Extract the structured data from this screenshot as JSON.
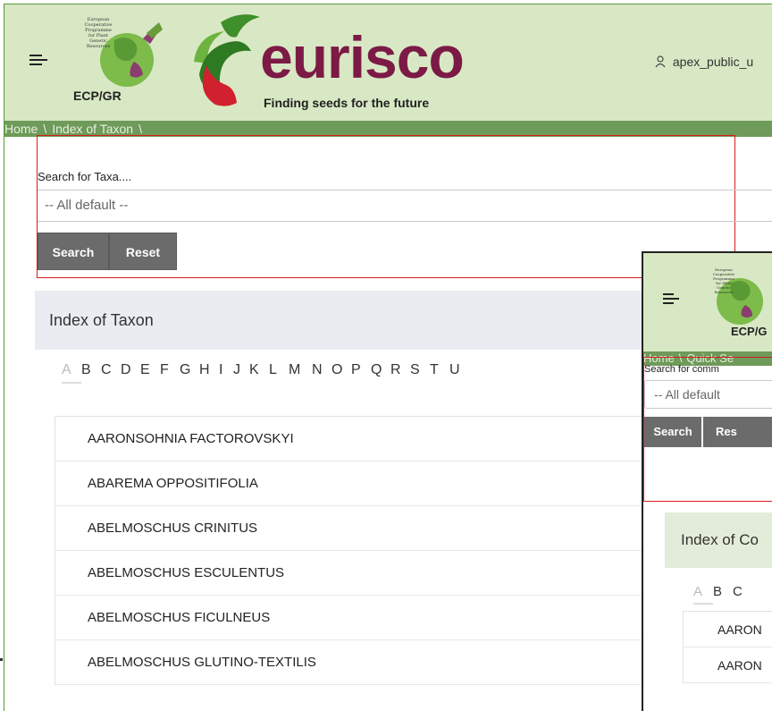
{
  "main_window": {
    "header": {
      "ecpgr_logo": {
        "text": "European\nCooperative\nProgramme\nfor Plant\nGenetic\nResources",
        "abbr": "ECP/GR"
      },
      "eurisco_logo": {
        "wordmark": "eurisco",
        "tagline": "Finding seeds for the future"
      },
      "user": {
        "icon": "user-icon",
        "name": "apex_public_u"
      },
      "menu_icon": "hamburger-icon"
    },
    "breadcrumb": [
      "Home",
      "Index of Taxon"
    ],
    "search": {
      "label": "Search for Taxa....",
      "select_value": "-- All default --",
      "search_button": "Search",
      "reset_button": "Reset"
    },
    "index": {
      "title": "Index of Taxon",
      "letters": [
        "A",
        "B",
        "C",
        "D",
        "E",
        "F",
        "G",
        "H",
        "I",
        "J",
        "K",
        "L",
        "M",
        "N",
        "O",
        "P",
        "Q",
        "R",
        "S",
        "T",
        "U"
      ],
      "active_letter": "A",
      "taxa": [
        "AARONSOHNIA FACTOROVSKYI",
        "ABAREMA OPPOSITIFOLIA",
        "ABELMOSCHUS CRINITUS",
        "ABELMOSCHUS ESCULENTUS",
        "ABELMOSCHUS FICULNEUS",
        "ABELMOSCHUS GLUTINO-TEXTILIS"
      ]
    }
  },
  "overlay_window": {
    "header": {
      "ecpgr_logo": {
        "text": "European\nCooperative\nProgramme\nfor Plant\nGenetic\nResources",
        "abbr": "ECP/G"
      },
      "menu_icon": "hamburger-icon"
    },
    "breadcrumb": [
      "Home",
      "Quick Se"
    ],
    "search": {
      "label": "Search for comm",
      "select_value": "-- All default",
      "search_button": "Search",
      "reset_button": "Res"
    },
    "index": {
      "title": "Index of Co",
      "letters": [
        "A",
        "B",
        "C"
      ],
      "active_letter": "A",
      "items": [
        "AARON",
        "AARON"
      ]
    }
  },
  "colors": {
    "header_bg": "#d8e8c4",
    "breadcrumb_bg": "#6e9a5a",
    "highlight_border": "#d81c1c",
    "button_bg": "#6b6b6b",
    "eurisco_red": "#7c1a46",
    "leaf_green": "#6db33f"
  }
}
